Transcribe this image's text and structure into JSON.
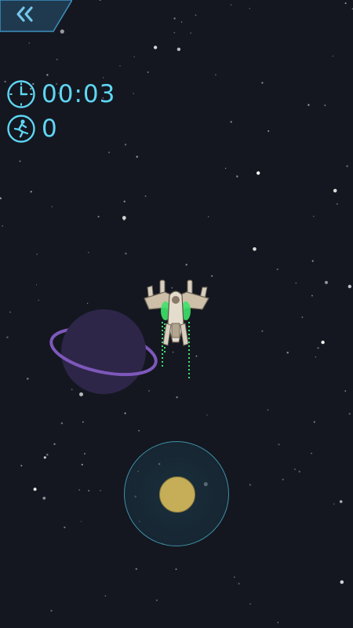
{
  "hud": {
    "timer": "00:03",
    "score": "0",
    "timer_icon": "clock-icon",
    "score_icon": "runner-icon"
  },
  "nav": {
    "back_icon": "double-chevron-left-icon"
  },
  "colors": {
    "background": "#141720",
    "hud_accent": "#5fd6f3",
    "planet": "#2e2648",
    "planet_ring": "#7e58bb",
    "joystick_knob": "#c5ae57",
    "thruster": "#3de36a"
  }
}
